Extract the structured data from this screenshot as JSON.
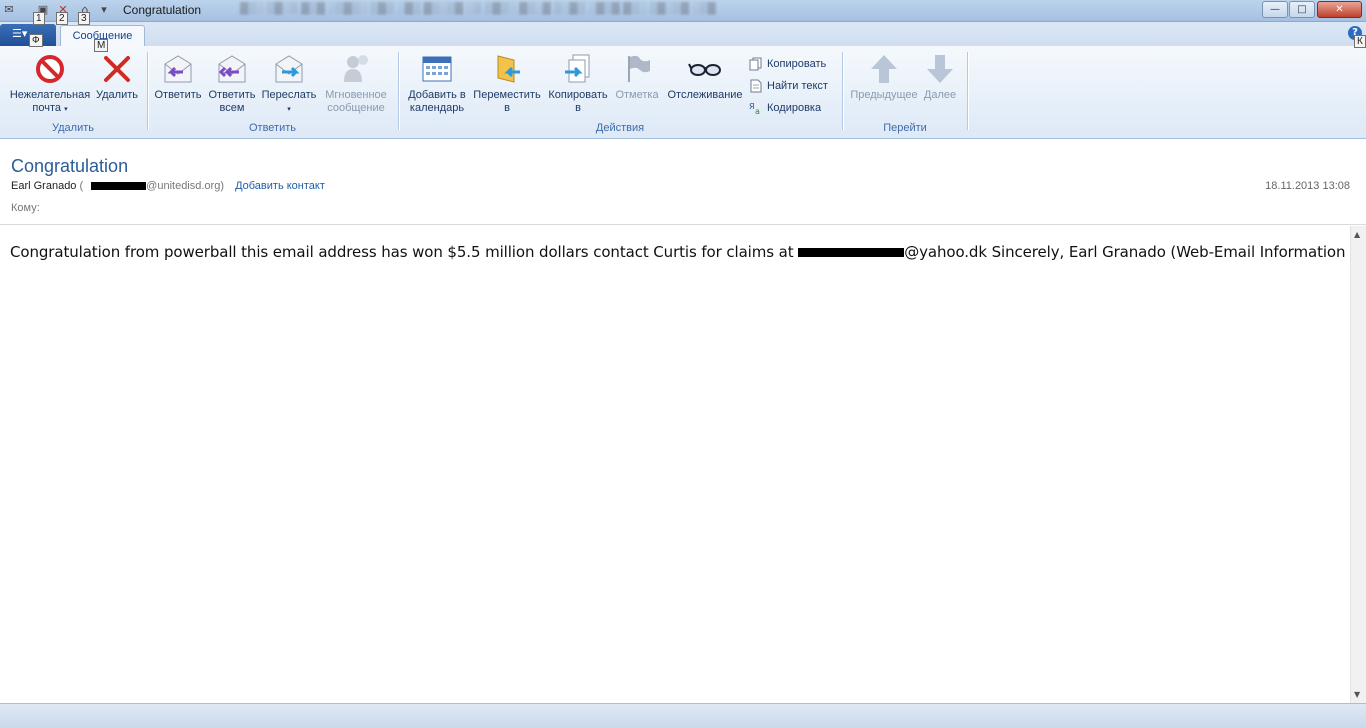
{
  "window": {
    "title": "Congratulation",
    "buttons": {
      "minimize": "—",
      "maximize": "□",
      "close": "✕"
    }
  },
  "qat": {
    "keytips": [
      "1",
      "2",
      "3"
    ],
    "menu_keytip": "Ф",
    "tab_keytip": "М",
    "help_keytip": "К"
  },
  "tabs": {
    "active": "Сообщение"
  },
  "ribbon": {
    "groups": {
      "delete": {
        "label": "Удалить",
        "junk": {
          "line1": "Нежелательная",
          "line2": "почта"
        },
        "delete": "Удалить"
      },
      "reply": {
        "label": "Ответить",
        "reply": "Ответить",
        "reply_all": {
          "line1": "Ответить",
          "line2": "всем"
        },
        "forward": "Переслать",
        "instant": {
          "line1": "Мгновенное",
          "line2": "сообщение"
        }
      },
      "actions": {
        "label": "Действия",
        "add_calendar": {
          "line1": "Добавить в",
          "line2": "календарь"
        },
        "move_to": {
          "line1": "Переместить",
          "line2": "в"
        },
        "copy_to": {
          "line1": "Копировать",
          "line2": "в"
        },
        "flag": "Отметка",
        "watch": "Отслеживание",
        "copy": "Копировать",
        "find_text": "Найти текст",
        "encoding": "Кодировка"
      },
      "navigate": {
        "label": "Перейти",
        "previous": "Предыдущее",
        "next": "Далее"
      }
    }
  },
  "message": {
    "subject": "Congratulation",
    "from_name": "Earl Granado",
    "from_paren_open": "(",
    "from_domain": "@unitedisd.org)",
    "add_contact": "Добавить контакт",
    "date": "18.11.2013 13:08",
    "to_label": "Кому:",
    "body_before": "Congratulation from powerball this email address has won $5.5 million dollars contact Curtis for claims at ",
    "body_after": "@yahoo.dk Sincerely, Earl Granado (Web-Email Information Manager)"
  },
  "colors": {
    "accent": "#2d5c99",
    "ribbon_text": "#1f3a66",
    "group_label": "#3e6aaa",
    "link": "#1e5ea8"
  }
}
